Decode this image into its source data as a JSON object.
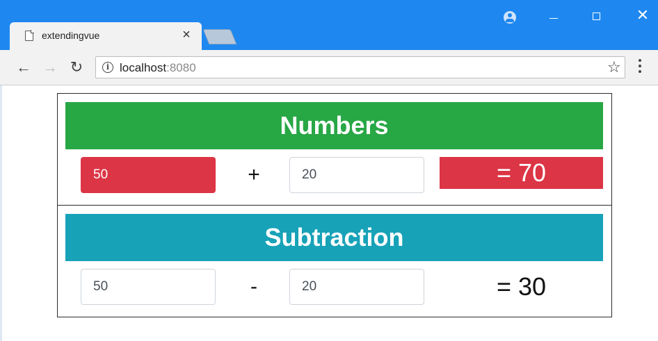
{
  "browser": {
    "tab_title": "extendingvue",
    "tab_close": "×",
    "url_host": "localhost",
    "url_port": ":8080",
    "nav": {
      "back": "←",
      "forward": "→",
      "reload": "↻"
    },
    "star": "☆",
    "window_close": "✕"
  },
  "numbers_panel": {
    "title": "Numbers",
    "title_color": "#28a745",
    "first_value": "50",
    "operator": "+",
    "second_value": "20",
    "result": "= 70",
    "accent_color": "#dc3545"
  },
  "subtraction_panel": {
    "title": "Subtraction",
    "title_color": "#17a2b8",
    "first_value": "50",
    "operator": "-",
    "second_value": "20",
    "result": "= 30"
  }
}
